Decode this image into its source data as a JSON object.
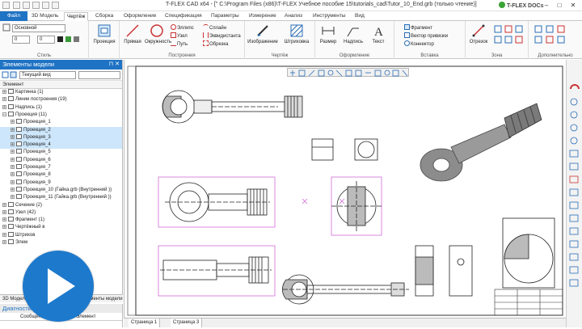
{
  "title": "T-FLEX CAD x64 - [\" C:\\Program Files (x86)\\T-FLEX Учебное пособие 15\\tutorials_cad\\Tutor_10_End.grb (только чтение)]",
  "docs_label": "T-FLEX DOCs",
  "tabs": [
    "Файл",
    "3D Модель",
    "Чертёж",
    "Сборка",
    "Оформление",
    "Спецификация",
    "Параметры",
    "Измерение",
    "Анализ",
    "Инструменты",
    "Вид"
  ],
  "ribbon": {
    "style_combo": "Основной",
    "style_value": "0",
    "style_value2": "0",
    "style_label": "Стиль",
    "projection": "Проекция",
    "construction": {
      "label": "Построения",
      "big": [
        "Прямая",
        "Окружность"
      ],
      "small": [
        "Эллипс",
        "Узел",
        "Путь",
        "Сплайн",
        "Эквидистанта",
        "Обрезка"
      ]
    },
    "drawing": {
      "label": "Чертёж",
      "big": [
        "Изображение",
        "Штриховка"
      ]
    },
    "annotation": {
      "label": "Оформление",
      "big": [
        "Размер",
        "Надпись",
        "Текст"
      ]
    },
    "insert": {
      "label": "Вставка",
      "small": [
        "Фрагмент",
        "Вектор привязки",
        "Коннектор"
      ]
    },
    "zoom": {
      "label": "Зона",
      "big": [
        "Отрезок"
      ]
    },
    "extra": {
      "label": "Дополнительно"
    }
  },
  "left_panel": {
    "title": "Элементы модели",
    "view_combo": "Текущий вид",
    "column": "Элемент",
    "tree": [
      {
        "label": "Картинка (1)",
        "level": 0,
        "expander": "+",
        "selected": false
      },
      {
        "label": "Линии построения (19)",
        "level": 0,
        "expander": "+",
        "selected": false
      },
      {
        "label": "Надпись (1)",
        "level": 0,
        "expander": "+",
        "selected": false
      },
      {
        "label": "Проекция (11)",
        "level": 0,
        "expander": "−",
        "selected": false
      },
      {
        "label": "Проекция_1",
        "level": 1,
        "expander": "+",
        "selected": false
      },
      {
        "label": "Проекция_2",
        "level": 1,
        "expander": "+",
        "selected": true
      },
      {
        "label": "Проекция_3",
        "level": 1,
        "expander": "+",
        "selected": true
      },
      {
        "label": "Проекция_4",
        "level": 1,
        "expander": "+",
        "selected": true
      },
      {
        "label": "Проекция_5",
        "level": 1,
        "expander": "+",
        "selected": false
      },
      {
        "label": "Проекция_6",
        "level": 1,
        "expander": "+",
        "selected": false
      },
      {
        "label": "Проекция_7",
        "level": 1,
        "expander": "+",
        "selected": false
      },
      {
        "label": "Проекция_8",
        "level": 1,
        "expander": "+",
        "selected": false
      },
      {
        "label": "Проекция_9",
        "level": 1,
        "expander": "+",
        "selected": false
      },
      {
        "label": "Проекция_10 (Гайка.grb (Внутренний ))",
        "level": 1,
        "expander": "+",
        "selected": false
      },
      {
        "label": "Проекция_11 (Гайка.grb (Внутренний ))",
        "level": 1,
        "expander": "+",
        "selected": false
      },
      {
        "label": "Сечение (2)",
        "level": 0,
        "expander": "+",
        "selected": false
      },
      {
        "label": "Узел (42)",
        "level": 0,
        "expander": "+",
        "selected": false
      },
      {
        "label": "Фрагмент (1)",
        "level": 0,
        "expander": "+",
        "selected": false
      },
      {
        "label": "Чертёжный в",
        "level": 0,
        "expander": "+",
        "selected": false
      },
      {
        "label": "Штрихов",
        "level": 0,
        "expander": "+",
        "selected": false
      },
      {
        "label": "Элем",
        "level": 0,
        "expander": "+",
        "selected": false
      }
    ],
    "bottom_tabs": [
      "3D Модель",
      "ементы модели"
    ]
  },
  "diagnostics": {
    "title": "Диагностика",
    "columns": [
      "Сообщение",
      "Элемент"
    ]
  },
  "page_tabs": [
    "Страница 1",
    "Страница 3"
  ],
  "colors": {
    "accent": "#1f73c4",
    "selection": "#cde6fb",
    "magenta_frame": "#d36cd8"
  }
}
